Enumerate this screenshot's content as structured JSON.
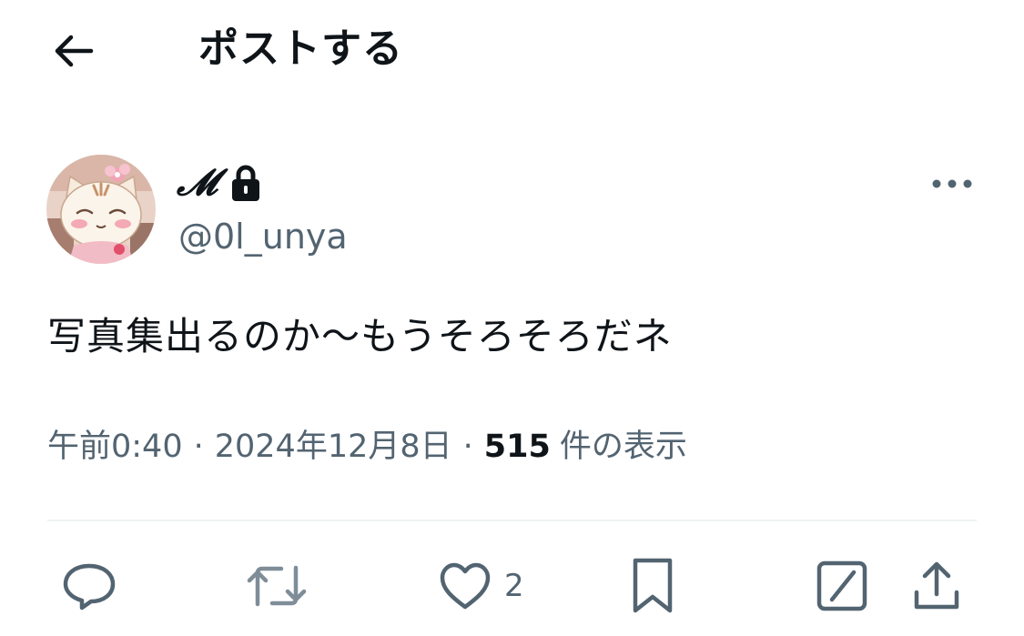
{
  "header": {
    "title": "ポストする",
    "back_icon": "arrow-left-icon"
  },
  "author": {
    "display_name": "𝓜",
    "handle": "@0l_unya",
    "protected_icon": "lock-icon",
    "avatar": "cat-avatar"
  },
  "post": {
    "text": "写真集出るのか〜もうそろそろだネ"
  },
  "meta": {
    "time": "午前0:40",
    "separator": "·",
    "date": "2024年12月8日",
    "views_count": "515",
    "views_label": "件の表示"
  },
  "actions": {
    "reply_icon": "reply-icon",
    "repost_icon": "repost-icon",
    "like_icon": "heart-icon",
    "like_count": "2",
    "bookmark_icon": "bookmark-icon",
    "grok_icon": "grok-icon",
    "share_icon": "share-icon"
  },
  "colors": {
    "text_primary": "#0f1419",
    "text_secondary": "#536471",
    "divider": "#eff3f4"
  }
}
